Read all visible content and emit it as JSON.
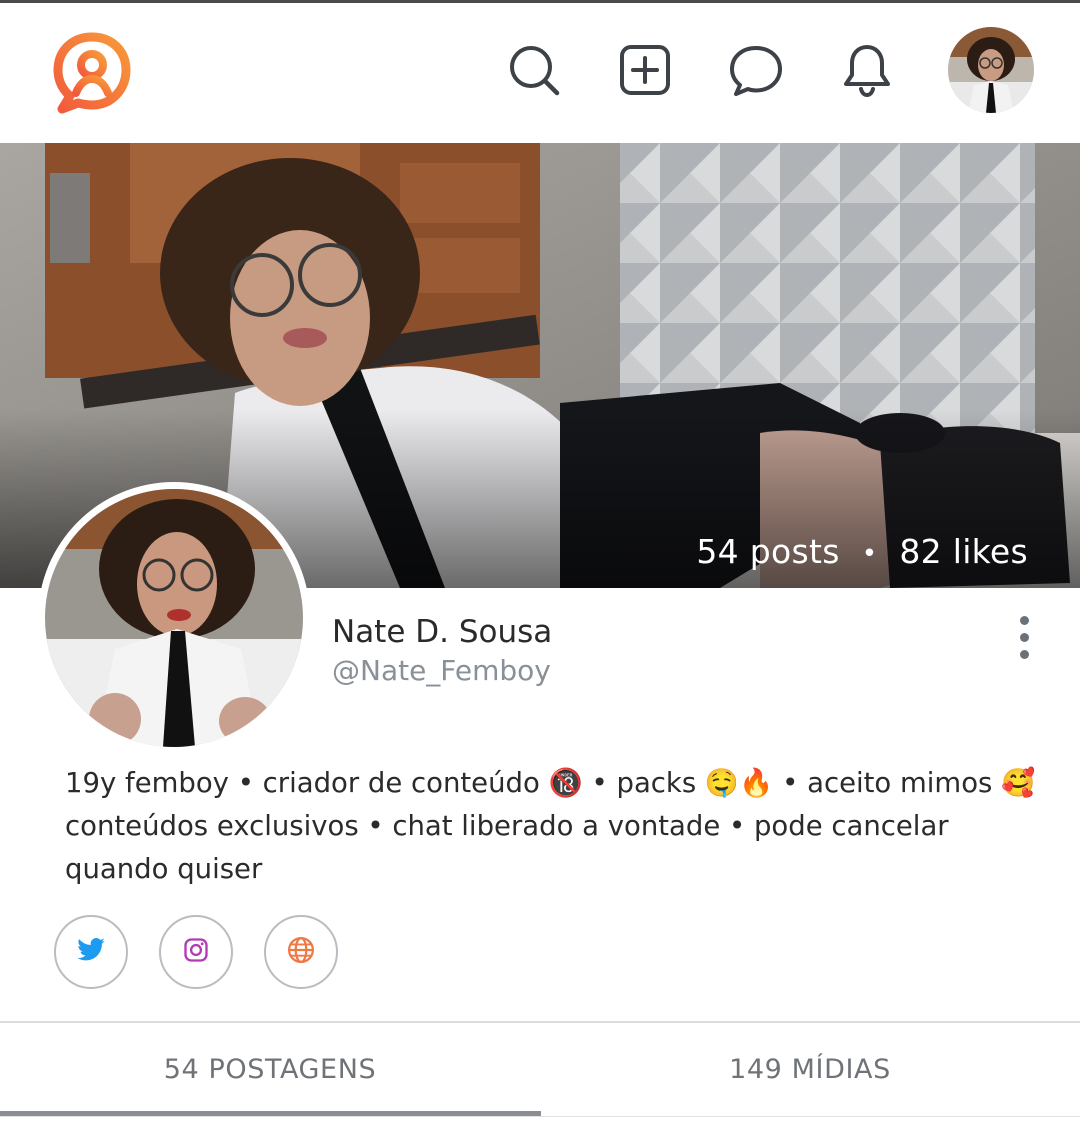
{
  "colors": {
    "brand": "#f26b3a",
    "icon": "#3d4248",
    "twitter": "#1d9bf0",
    "instagram": "#b43ab5",
    "website": "#f07845"
  },
  "header": {
    "logo_icon": "brand-logo-icon",
    "icons": [
      "search-icon",
      "add-post-icon",
      "chat-icon",
      "bell-icon"
    ]
  },
  "cover": {
    "posts": "54 posts",
    "separator": "•",
    "likes": "82 likes"
  },
  "profile": {
    "name": "Nate D. Sousa",
    "handle": "@Nate_Femboy",
    "bio": "19y femboy • criador de conteúdo 🔞 • packs 🤤🔥 • aceito mimos 🥰 conteúdos exclusivos • chat liberado a vontade • pode cancelar quando quiser"
  },
  "social": [
    "twitter-icon",
    "instagram-icon",
    "globe-icon"
  ],
  "tabs": [
    {
      "label": "54 POSTAGENS",
      "active": true
    },
    {
      "label": "149 MÍDIAS",
      "active": false
    }
  ]
}
